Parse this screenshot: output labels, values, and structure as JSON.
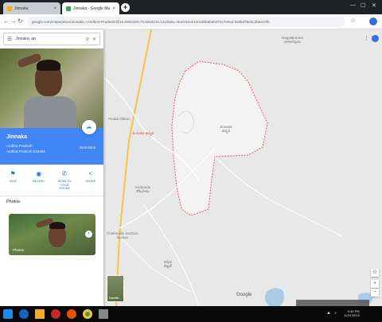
{
  "browser": {
    "tabs": [
      {
        "label": "Jinnaka",
        "active": false
      },
      {
        "label": "Jinnaka - Google Ma",
        "active": true
      }
    ],
    "new_tab_label": "+",
    "url": "google.com/maps/place/Jinnaka,+Andhra+Pradesh/@15.5802359,78.6263218,14z/data=!4m5!3m4!1s0x3bb5bd6473c7e0cd:0x9bd76e5c2b54c0f0",
    "window_controls": [
      "—",
      "☐",
      "✕"
    ]
  },
  "panel": {
    "search_value": "Jinnaka, ap",
    "place_name": "Jinnaka",
    "place_type": "Andhra Pradesh",
    "place_sub": "Andhra Pradesh 518466",
    "directions_label": "Directions",
    "actions": [
      {
        "icon": "bookmark-icon",
        "glyph": "⚑",
        "label": "SAVE"
      },
      {
        "icon": "nearby-icon",
        "glyph": "◉",
        "label": "NEARBY"
      },
      {
        "icon": "phone-icon",
        "glyph": "✆",
        "label": "SEND TO YOUR PHONE"
      },
      {
        "icon": "share-icon",
        "glyph": "<",
        "label": "SHARE"
      }
    ],
    "photos_heading": "Photos",
    "photo_caption": "Photos"
  },
  "map": {
    "labels": {
      "top_right": "Nagalapuram\nనాగలాపురం",
      "village_center": "Jinnaka\nజిన్నక",
      "red_place": "Jinnaka జిన్నక",
      "left_top": "Pedda Oblam",
      "left_mid": "Kotapadu\nకోటపాడు",
      "left_low": "Chelamala Junction\nచెలమల",
      "bottom": "Biljal\nబిల్జల్"
    },
    "google_logo": "Google",
    "layers_label": "Satellite",
    "zoom_in": "+",
    "zoom_out": "−",
    "locate": "⊙"
  },
  "taskbar": {
    "time": "6:46 PM",
    "date": "10/11/2018"
  }
}
